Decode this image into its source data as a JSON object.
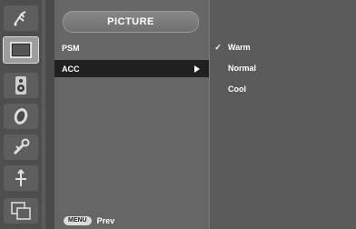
{
  "menu": {
    "title": "PICTURE",
    "items": [
      {
        "label": "PSM"
      },
      {
        "label": "ACC",
        "selected": true
      }
    ]
  },
  "options": [
    {
      "label": "Warm",
      "checked": true
    },
    {
      "label": "Normal",
      "checked": false
    },
    {
      "label": "Cool",
      "checked": false
    }
  ],
  "check_mark": "✓",
  "footer": {
    "menu_button": "MENU",
    "prev_label": "Prev"
  },
  "sidebar_icons": [
    "antenna-icon",
    "picture-icon",
    "speaker-icon",
    "clock-icon",
    "settings-tools-icon",
    "pip-icon",
    "input-source-icon"
  ],
  "colors": {
    "background": "#5b5b5b",
    "selected_row": "#202020",
    "text": "#ffffff"
  }
}
